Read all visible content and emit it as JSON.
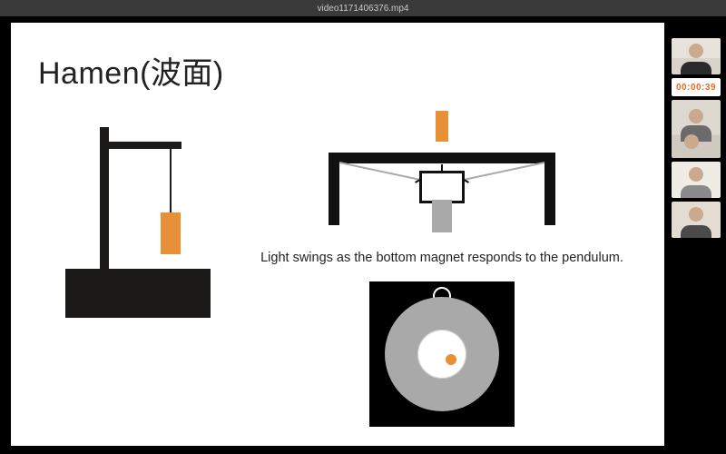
{
  "titlebar": {
    "filename": "video1171406376.mp4"
  },
  "slide": {
    "title": "Hamen(波面)",
    "caption": "Light swings as the bottom magnet responds to the pendulum."
  },
  "sidebar": {
    "timer": "00:00:39",
    "participants": [
      {
        "id": "p1"
      },
      {
        "id": "p2"
      },
      {
        "id": "p3"
      },
      {
        "id": "p4"
      }
    ]
  },
  "colors": {
    "accent": "#e79037",
    "timer": "#e66a1f"
  }
}
